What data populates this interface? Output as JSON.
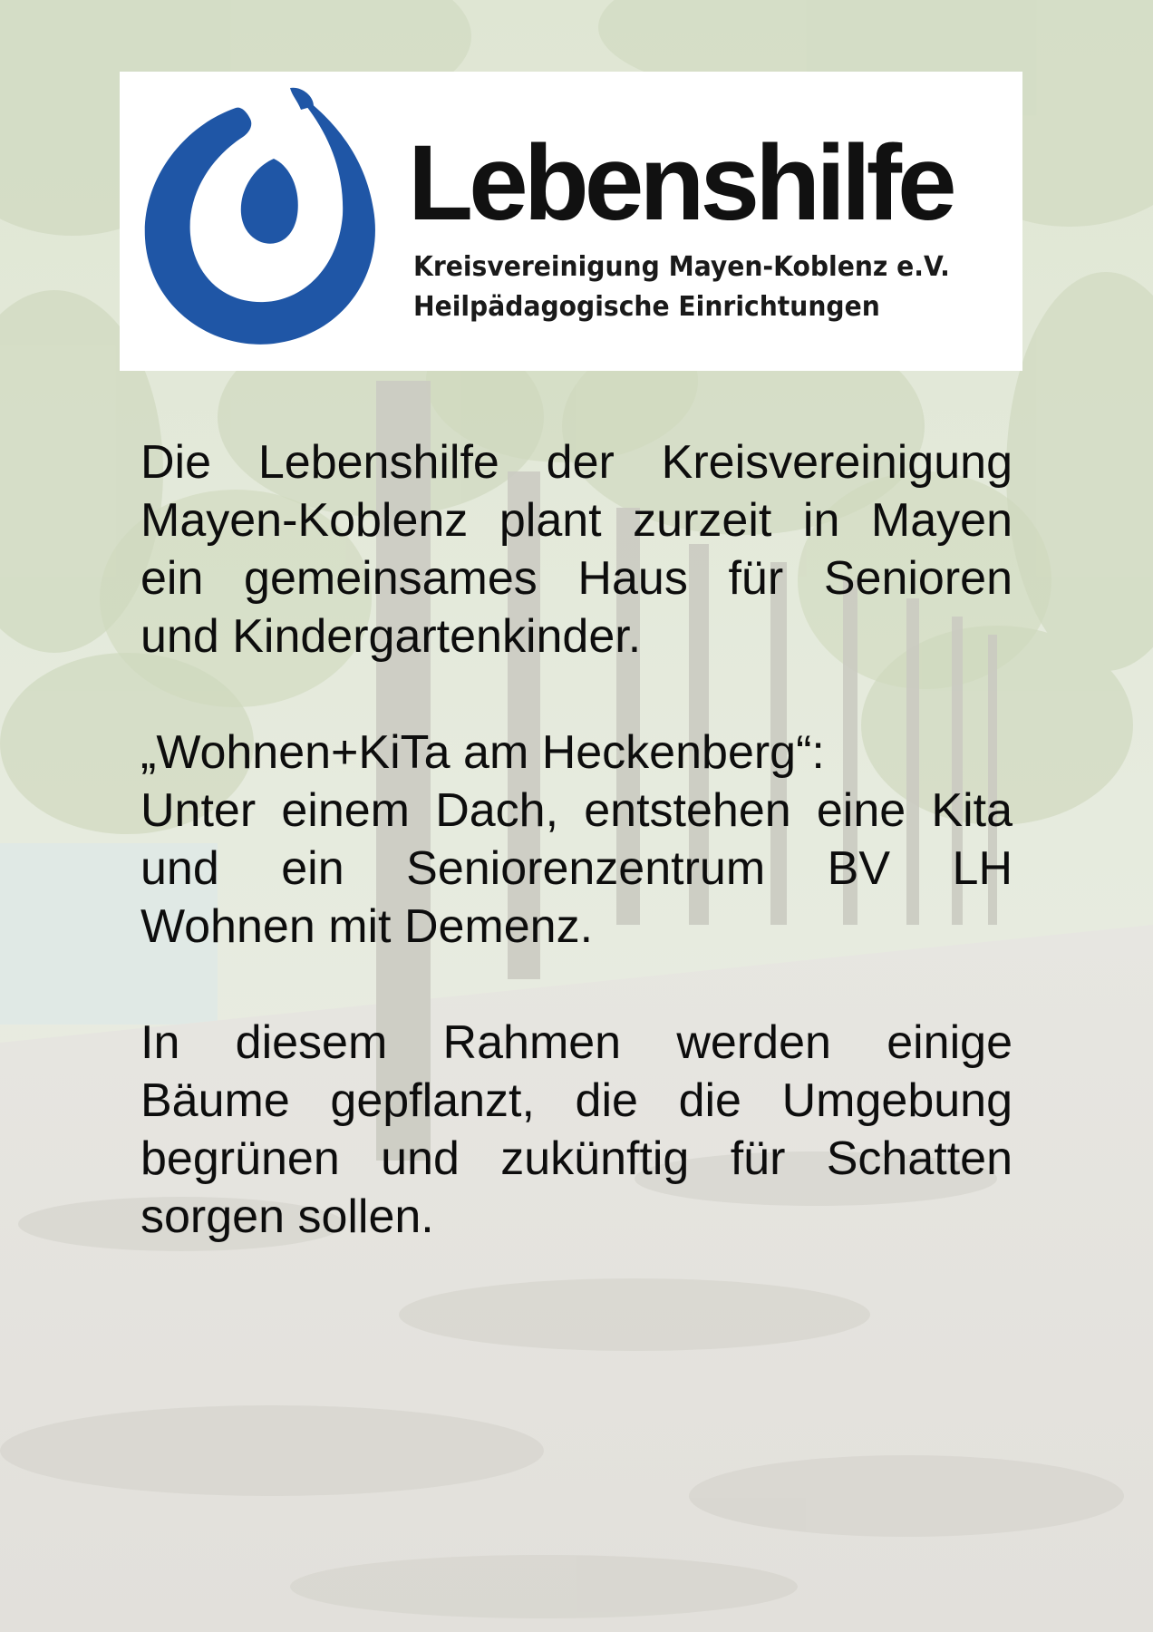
{
  "logo": {
    "icon": "lebenshilfe-logo-icon",
    "wordmark": "Lebenshilfe",
    "subline_1": "Kreisvereinigung Mayen-Koblenz e.V.",
    "subline_2": "Heilpädagogische Einrichtungen",
    "brand_color": "#1f56a6"
  },
  "background": {
    "description_icon": "tree-avenue-photo"
  },
  "paragraphs": [
    {
      "lines": [
        "Die Lebenshilfe der Kreisvereinigung",
        "Mayen-Koblenz plant zurzeit in Mayen",
        "ein gemeinsames Haus für Senioren",
        "und Kindergartenkinder."
      ]
    },
    {
      "lines": [
        "„Wohnen+KiTa am Heckenberg“:",
        "Unter einem Dach, entstehen eine Kita",
        "und ein Seniorenzentrum BV LH",
        "Wohnen mit Demenz."
      ]
    },
    {
      "lines": [
        "In diesem Rahmen werden einige",
        "Bäume gepflanzt, die die Umgebung",
        "begrünen und zukünftig für Schatten",
        "sorgen sollen."
      ]
    }
  ]
}
